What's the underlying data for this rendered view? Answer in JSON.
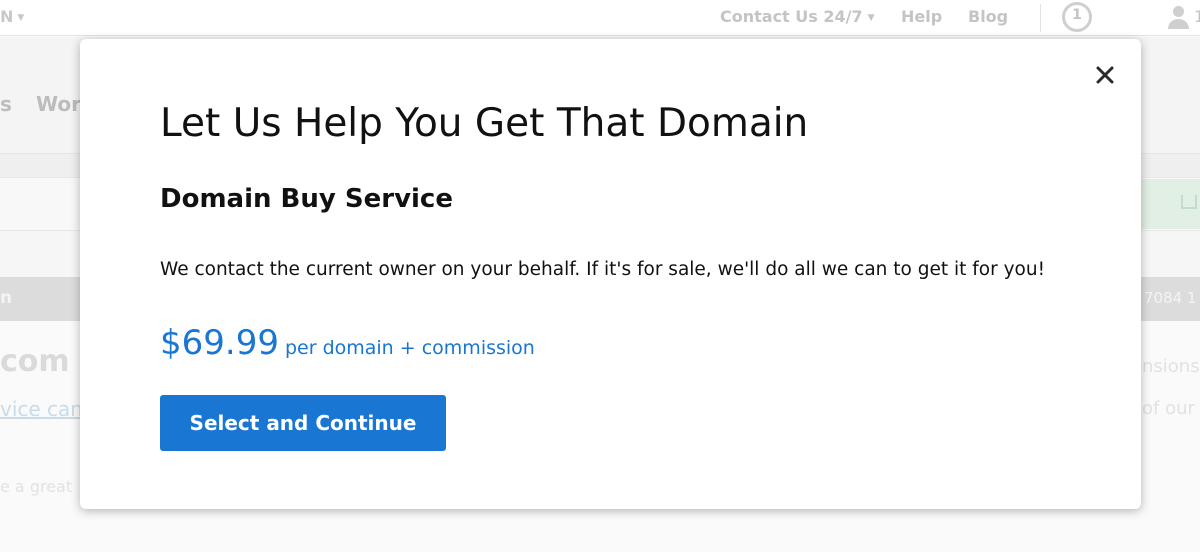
{
  "background": {
    "topbar": {
      "left_fragment": "N",
      "contact": "Contact Us 24/7",
      "help": "Help",
      "blog": "Blog",
      "cart_count": "1",
      "user_fragment": "1"
    },
    "nav_fragments": {
      "first": "s",
      "second": "Wor"
    },
    "grey_bar": {
      "left": "n",
      "right": "7084 1"
    },
    "content_fragments": {
      "headline": "com i",
      "link": "vice can",
      "tagline": "e a great",
      "right_top": "nsions",
      "right_bottom": "of our"
    }
  },
  "modal": {
    "title": "Let Us Help You Get That Domain",
    "subtitle": "Domain Buy Service",
    "description": "We contact the current owner on your behalf. If it's for sale, we'll do all we can to get it for you!",
    "price": "$69.99",
    "price_suffix": "per domain + commission",
    "cta_label": "Select and Continue",
    "close_icon": "close-icon"
  },
  "colors": {
    "accent": "#1976d2",
    "text": "#111111"
  }
}
